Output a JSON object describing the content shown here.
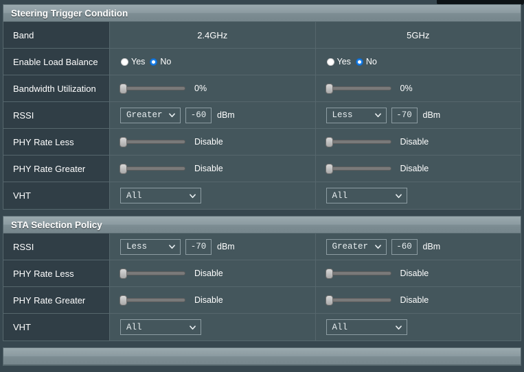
{
  "panels": [
    {
      "title": "Steering Trigger Condition",
      "rows": [
        {
          "label": "Band",
          "type": "text",
          "cells": [
            "2.4GHz",
            "5GHz"
          ]
        },
        {
          "label": "Enable Load Balance",
          "type": "radio",
          "cells": [
            {
              "options": [
                "Yes",
                "No"
              ],
              "selected": "No"
            },
            {
              "options": [
                "Yes",
                "No"
              ],
              "selected": "No"
            }
          ]
        },
        {
          "label": "Bandwidth Utilization",
          "type": "slider",
          "cells": [
            {
              "value_text": "0%",
              "position": 0
            },
            {
              "value_text": "0%",
              "position": 0
            }
          ]
        },
        {
          "label": "RSSI",
          "type": "compare",
          "cells": [
            {
              "comparator": "Greater",
              "value": "-60",
              "unit": "dBm",
              "select_width": "narrow"
            },
            {
              "comparator": "Less",
              "value": "-70",
              "unit": "dBm",
              "select_width": "narrow"
            }
          ]
        },
        {
          "label": "PHY Rate Less",
          "type": "slider",
          "cells": [
            {
              "value_text": "Disable",
              "position": 0
            },
            {
              "value_text": "Disable",
              "position": 0
            }
          ]
        },
        {
          "label": "PHY Rate Greater",
          "type": "slider",
          "cells": [
            {
              "value_text": "Disable",
              "position": 0
            },
            {
              "value_text": "Disable",
              "position": 0
            }
          ]
        },
        {
          "label": "VHT",
          "type": "select",
          "cells": [
            {
              "selected": "All",
              "select_width": "wide"
            },
            {
              "selected": "All",
              "select_width": "wide"
            }
          ]
        }
      ]
    },
    {
      "title": "STA Selection Policy",
      "rows": [
        {
          "label": "RSSI",
          "type": "compare",
          "cells": [
            {
              "comparator": "Less",
              "value": "-70",
              "unit": "dBm",
              "select_width": "narrow"
            },
            {
              "comparator": "Greater",
              "value": "-60",
              "unit": "dBm",
              "select_width": "narrow"
            }
          ]
        },
        {
          "label": "PHY Rate Less",
          "type": "slider",
          "cells": [
            {
              "value_text": "Disable",
              "position": 0
            },
            {
              "value_text": "Disable",
              "position": 0
            }
          ]
        },
        {
          "label": "PHY Rate Greater",
          "type": "slider",
          "cells": [
            {
              "value_text": "Disable",
              "position": 0
            },
            {
              "value_text": "Disable",
              "position": 0
            }
          ]
        },
        {
          "label": "VHT",
          "type": "select",
          "cells": [
            {
              "selected": "All",
              "select_width": "wide"
            },
            {
              "selected": "All",
              "select_width": "wide"
            }
          ]
        }
      ]
    },
    {
      "title": "",
      "rows": []
    }
  ],
  "icons": {
    "caret": "chevron-down-icon"
  },
  "colors": {
    "page_background": "#37474f",
    "panel_value_background": "#44565c",
    "panel_label_background": "#303e46",
    "border": "#56676d",
    "radio_selected": "#1a7fe8",
    "text": "#ffffff"
  }
}
